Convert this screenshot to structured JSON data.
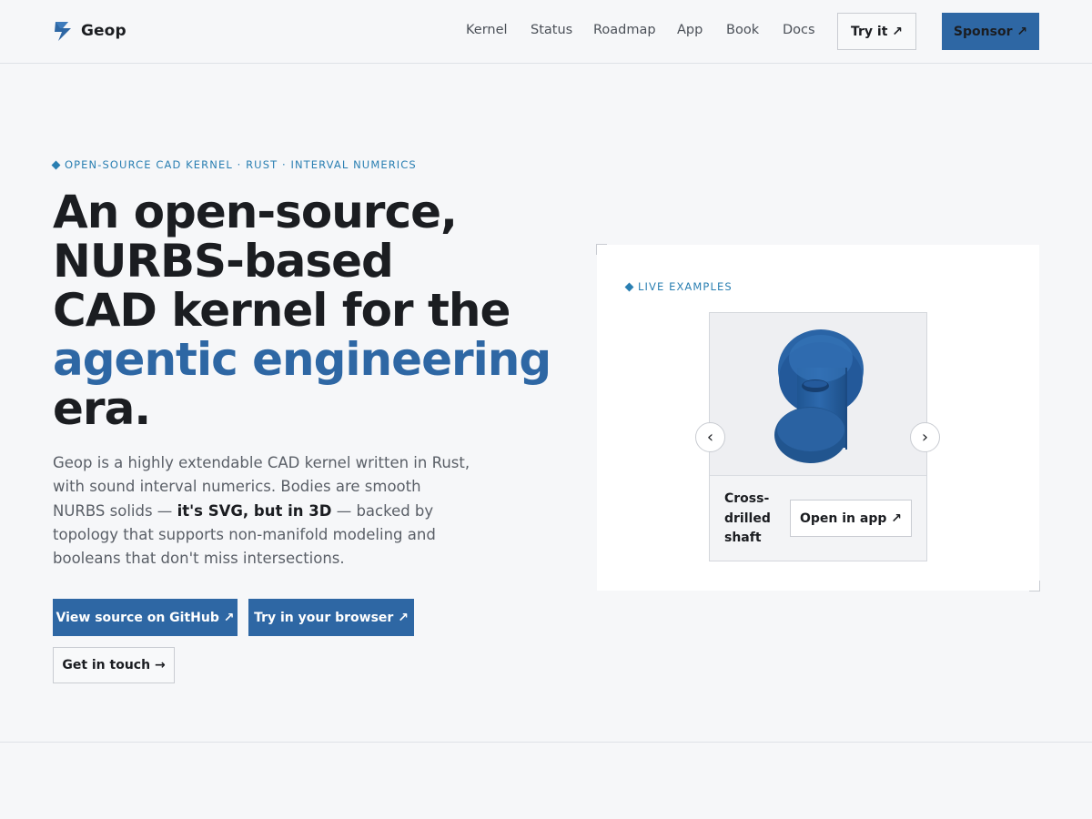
{
  "header": {
    "brand": "Geop",
    "nav": [
      "Kernel",
      "Status",
      "Roadmap",
      "App",
      "Book",
      "Docs"
    ],
    "try_label": "Try it ↗",
    "sponsor_label": "Sponsor ↗"
  },
  "hero": {
    "eyebrow": "OPEN-SOURCE CAD KERNEL · RUST · INTERVAL NUMERICS",
    "headline": {
      "line1": "An open-source,",
      "line2": "NURBS-based",
      "line3": "CAD kernel for the",
      "accent": "agentic engineering",
      "line5": "era."
    },
    "lede": {
      "part1": "Geop is a highly extendable CAD kernel written in Rust, with sound interval numerics. Bodies are smooth NURBS solids — ",
      "bold": "it's SVG, but in 3D",
      "part2": " — backed by topology that supports non-manifold modeling and booleans that don't miss intersections."
    },
    "buttons": {
      "github": "View source on GitHub ↗",
      "browser": "Try in your browser ↗",
      "contact": "Get in touch →"
    }
  },
  "examples": {
    "eyebrow": "LIVE EXAMPLES",
    "current": {
      "title": "Cross-drilled shaft",
      "open_label": "Open in app ↗"
    },
    "prev_glyph": "‹",
    "next_glyph": "›"
  },
  "colors": {
    "accent": "#2e67a4",
    "eyebrow": "#2a7fb2",
    "background": "#f6f7f9",
    "text": "#1b1d21",
    "muted": "#5a5f67"
  }
}
